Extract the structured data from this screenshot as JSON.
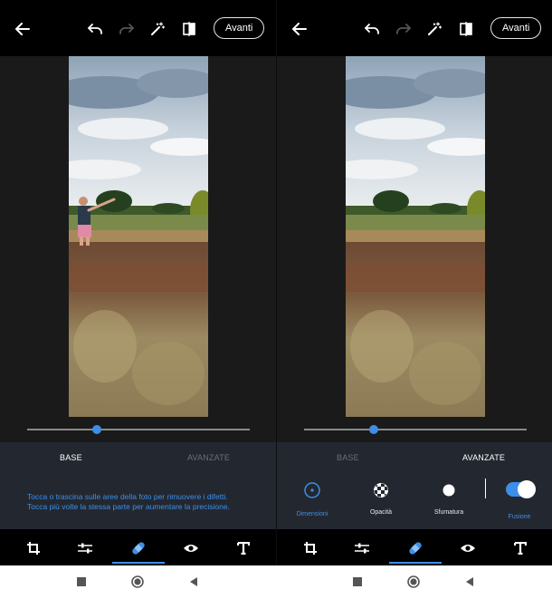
{
  "screens": [
    {
      "topbar": {
        "next_label": "Avanti"
      },
      "tabs": {
        "base": "BASE",
        "advanced": "AVANZATE",
        "active": "base"
      },
      "hint_line1": "Tocca o trascina sulle aree della foto per rimuovere i difetti.",
      "hint_line2": "Tocca più volte la stessa parte per aumentare la precisione.",
      "photo_shows_person": true
    },
    {
      "topbar": {
        "next_label": "Avanti"
      },
      "tabs": {
        "base": "BASE",
        "advanced": "AVANZATE",
        "active": "advanced"
      },
      "options": {
        "size": "Dimensioni",
        "opacity": "Opacità",
        "feather": "Sfumatura",
        "fusion": "Fusione",
        "fusion_enabled": true
      },
      "photo_shows_person": false
    }
  ],
  "colors": {
    "accent": "#3d8ee8",
    "topbar_bg": "#000000",
    "options_bg": "#232830",
    "canvas_bg": "#1a1a1a"
  },
  "icons": {
    "topbar": [
      "back-arrow-icon",
      "undo-icon",
      "redo-icon",
      "magic-wand-icon",
      "compare-icon"
    ],
    "toolbar": [
      "crop-icon",
      "adjust-sliders-icon",
      "heal-bandage-icon",
      "eye-icon",
      "text-icon"
    ],
    "navigation": [
      "recent-apps-icon",
      "home-icon",
      "back-triangle-icon"
    ]
  },
  "active_tool": "heal-bandage-icon"
}
